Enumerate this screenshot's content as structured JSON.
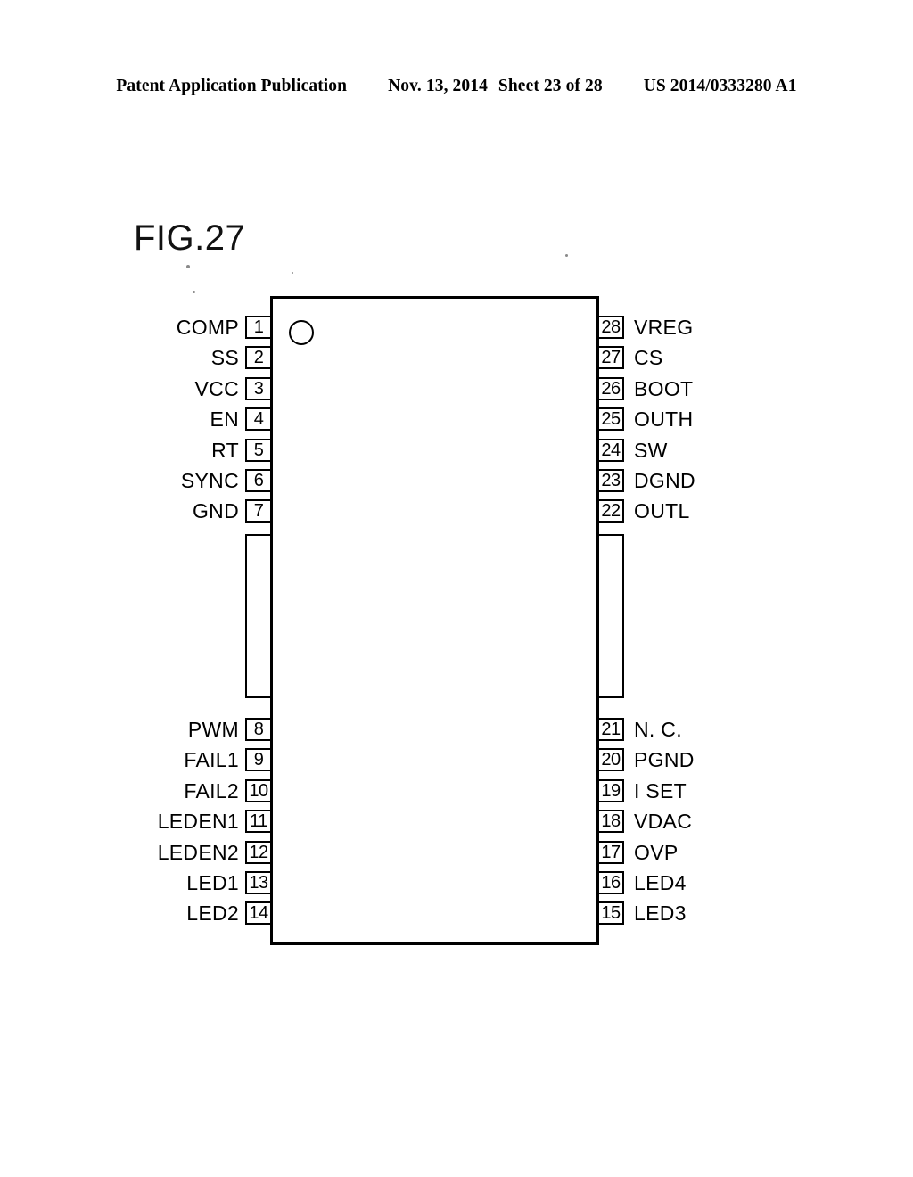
{
  "header": {
    "publication": "Patent Application Publication",
    "date": "Nov. 13, 2014",
    "sheet": "Sheet 23 of 28",
    "document_number": "US 2014/0333280 A1"
  },
  "figure": {
    "title": "FIG.27",
    "package_type": "integrated-circuit-pinout",
    "pin1_indicator": "circle-dot",
    "total_pins": 28,
    "left_pins": [
      {
        "number": "1",
        "name": "COMP"
      },
      {
        "number": "2",
        "name": "SS"
      },
      {
        "number": "3",
        "name": "VCC"
      },
      {
        "number": "4",
        "name": "EN"
      },
      {
        "number": "5",
        "name": "RT"
      },
      {
        "number": "6",
        "name": "SYNC"
      },
      {
        "number": "7",
        "name": "GND"
      },
      {
        "number": "8",
        "name": "PWM"
      },
      {
        "number": "9",
        "name": "FAIL1"
      },
      {
        "number": "10",
        "name": "FAIL2"
      },
      {
        "number": "11",
        "name": "LEDEN1"
      },
      {
        "number": "12",
        "name": "LEDEN2"
      },
      {
        "number": "13",
        "name": "LED1"
      },
      {
        "number": "14",
        "name": "LED2"
      }
    ],
    "right_pins": [
      {
        "number": "28",
        "name": "VREG"
      },
      {
        "number": "27",
        "name": "CS"
      },
      {
        "number": "26",
        "name": "BOOT"
      },
      {
        "number": "25",
        "name": "OUTH"
      },
      {
        "number": "24",
        "name": "SW"
      },
      {
        "number": "23",
        "name": "DGND"
      },
      {
        "number": "22",
        "name": "OUTL"
      },
      {
        "number": "21",
        "name": "N. C."
      },
      {
        "number": "20",
        "name": "PGND"
      },
      {
        "number": "19",
        "name": "I SET"
      },
      {
        "number": "18",
        "name": "VDAC"
      },
      {
        "number": "17",
        "name": "OVP"
      },
      {
        "number": "16",
        "name": "LED4"
      },
      {
        "number": "15",
        "name": "LED3"
      }
    ],
    "colors": {
      "ink": "#000000",
      "paper": "#ffffff"
    }
  }
}
